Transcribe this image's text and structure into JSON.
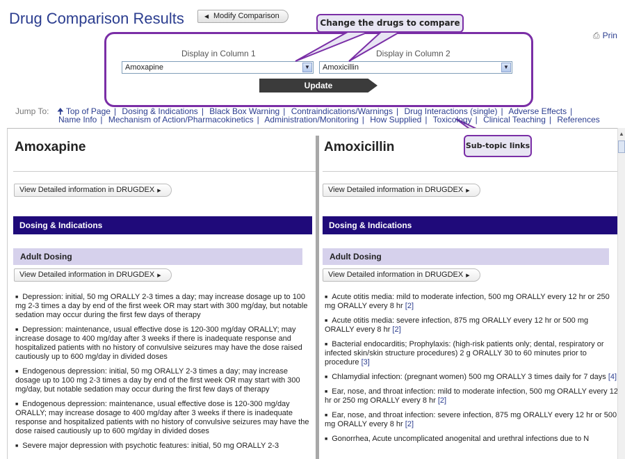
{
  "header": {
    "title": "Drug Comparison Results",
    "modify_button": "Modify Comparison",
    "print_label": "Prin"
  },
  "callouts": {
    "change": "Change the drugs to compare",
    "subtopic": "Sub-topic links"
  },
  "selector": {
    "col1_label": "Display in Column 1",
    "col2_label": "Display in Column 2",
    "col1_value": "Amoxapine",
    "col2_value": "Amoxicillin",
    "update_label": "Update"
  },
  "jump": {
    "label": "Jump To:",
    "links_row1": [
      "Top of Page",
      "Dosing & Indications",
      "Black Box Warning",
      "Contraindications/Warnings",
      "Drug Interactions (single)",
      "Adverse Effects"
    ],
    "links_row2": [
      "Name Info",
      "Mechanism of Action/Pharmacokinetics",
      "Administration/Monitoring",
      "How Supplied",
      "Toxicology",
      "Clinical Teaching",
      "References"
    ]
  },
  "columns": [
    {
      "drug": "Amoxapine",
      "detail_label": "View Detailed information in DRUGDEX",
      "section": "Dosing & Indications",
      "subsection": "Adult Dosing",
      "detail_label2": "View Detailed information in DRUGDEX",
      "items": [
        {
          "text": "Depression: initial, 50 mg ORALLY 2-3 times a day; may increase dosage up to 100 mg 2-3 times a day by end of the first week OR may start with 300 mg/day, but notable sedation may occur during the first few days of therapy",
          "ref": ""
        },
        {
          "text": "Depression: maintenance, usual effective dose is 120-300 mg/day ORALLY; may increase dosage to 400 mg/day after 3 weeks if there is inadequate response and hospitalized patients with no history of convulsive seizures may have the dose raised cautiously up to 600 mg/day in divided doses",
          "ref": ""
        },
        {
          "text": "Endogenous depression: initial, 50 mg ORALLY 2-3 times a day; may increase dosage up to 100 mg 2-3 times a day by end of the first week OR may start with 300 mg/day, but notable sedation may occur during the first few days of therapy",
          "ref": ""
        },
        {
          "text": "Endogenous depression: maintenance, usual effective dose is 120-300 mg/day ORALLY; may increase dosage to 400 mg/day after 3 weeks if there is inadequate response and hospitalized patients with no history of convulsive seizures may have the dose raised cautiously up to 600 mg/day in divided doses",
          "ref": ""
        },
        {
          "text": "Severe major depression with psychotic features: initial, 50 mg ORALLY 2-3",
          "ref": ""
        }
      ]
    },
    {
      "drug": "Amoxicillin",
      "detail_label": "View Detailed information in DRUGDEX",
      "section": "Dosing & Indications",
      "subsection": "Adult Dosing",
      "detail_label2": "View Detailed information in DRUGDEX",
      "items": [
        {
          "text": "Acute otitis media: mild to moderate infection, 500 mg ORALLY every 12 hr or 250 mg ORALLY every 8 hr",
          "ref": "[2]"
        },
        {
          "text": "Acute otitis media: severe infection, 875 mg ORALLY every 12 hr or 500 mg ORALLY every 8 hr",
          "ref": "[2]"
        },
        {
          "text": "Bacterial endocarditis; Prophylaxis: (high-risk patients only; dental, respiratory or infected skin/skin structure procedures) 2 g ORALLY 30 to 60 minutes prior to procedure",
          "ref": "[3]"
        },
        {
          "text": "Chlamydial infection: (pregnant women) 500 mg ORALLY 3 times daily for 7 days",
          "ref": "[4]"
        },
        {
          "text": "Ear, nose, and throat infection: mild to moderate infection, 500 mg ORALLY every 12 hr or 250 mg ORALLY every 8 hr",
          "ref": "[2]"
        },
        {
          "text": "Ear, nose, and throat infection: severe infection, 875 mg ORALLY every 12 hr or 500 mg ORALLY every 8 hr",
          "ref": "[2]"
        },
        {
          "text": "Gonorrhea, Acute uncomplicated anogenital and urethral infections due to N",
          "ref": ""
        }
      ]
    }
  ],
  "colors": {
    "title_blue": "#2b3d8f",
    "callout_purple": "#7a2ea6",
    "section_bar": "#1f0a7a",
    "subsection_bar": "#d6d1ec"
  }
}
